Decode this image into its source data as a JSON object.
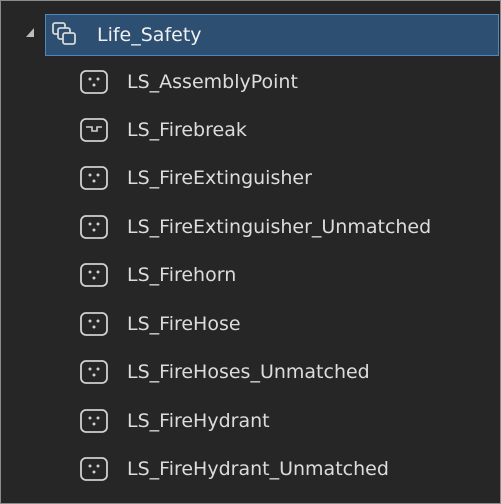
{
  "tree": {
    "root": {
      "label": "Life_Safety",
      "icon": "feature-dataset-icon",
      "expanded": true,
      "selected": true
    },
    "items": [
      {
        "label": "LS_AssemblyPoint",
        "icon": "point-feature-class-icon"
      },
      {
        "label": "LS_Firebreak",
        "icon": "line-feature-class-icon"
      },
      {
        "label": "LS_FireExtinguisher",
        "icon": "point-feature-class-icon"
      },
      {
        "label": "LS_FireExtinguisher_Unmatched",
        "icon": "point-feature-class-icon"
      },
      {
        "label": "LS_Firehorn",
        "icon": "point-feature-class-icon"
      },
      {
        "label": "LS_FireHose",
        "icon": "point-feature-class-icon"
      },
      {
        "label": "LS_FireHoses_Unmatched",
        "icon": "point-feature-class-icon"
      },
      {
        "label": "LS_FireHydrant",
        "icon": "point-feature-class-icon"
      },
      {
        "label": "LS_FireHydrant_Unmatched",
        "icon": "point-feature-class-icon"
      }
    ]
  },
  "colors": {
    "background": "#262626",
    "selection": "#2d4f72",
    "selection_border": "#4f86bd",
    "text": "#dcdcdc"
  }
}
